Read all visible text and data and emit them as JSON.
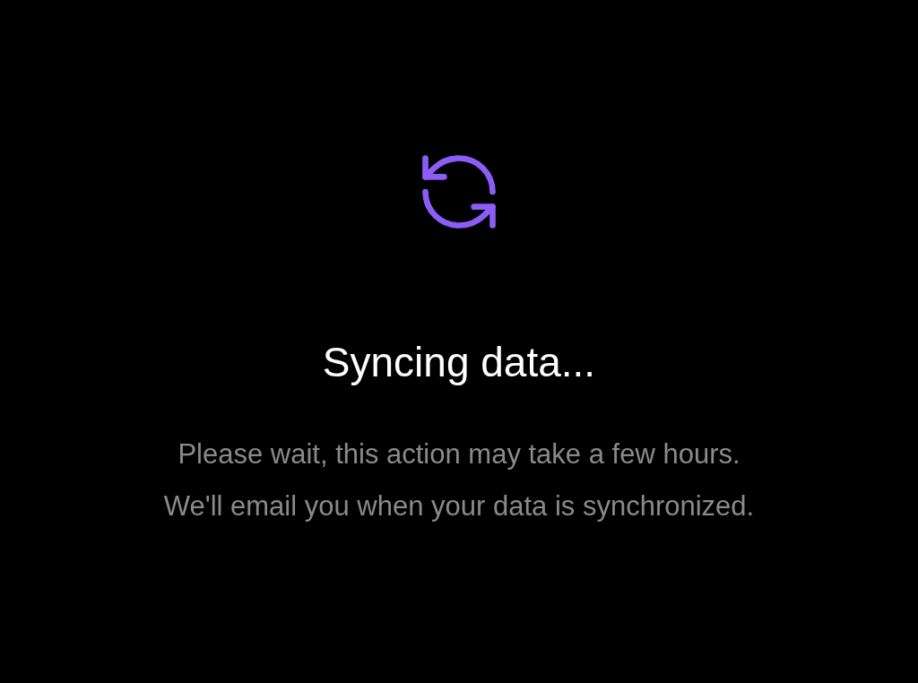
{
  "title": "Syncing data...",
  "message": [
    "Please wait, this action may take a few hours.",
    "We'll email you when your data is synchronized."
  ]
}
